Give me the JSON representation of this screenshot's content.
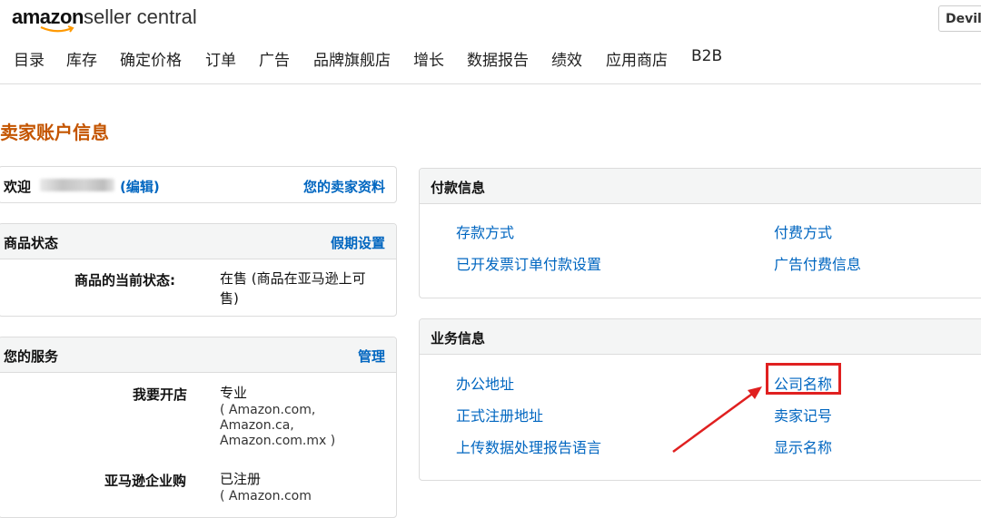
{
  "header": {
    "logo_brand": "amazon",
    "logo_product": "seller central",
    "user_button": "Devily"
  },
  "nav": {
    "items": [
      "目录",
      "库存",
      "确定价格",
      "订单",
      "广告",
      "品牌旗舰店",
      "增长",
      "数据报告",
      "绩效",
      "应用商店",
      "B2B"
    ]
  },
  "page": {
    "title": "卖家账户信息"
  },
  "welcome_card": {
    "welcome": "欢迎",
    "edit": "(编辑)",
    "profile_link": "您的卖家资料"
  },
  "listing_status": {
    "title": "商品状态",
    "vacation_link": "假期设置",
    "label": "商品的当前状态:",
    "value_line1": "在售 (商品在亚马逊上可",
    "value_line2": "售)"
  },
  "services": {
    "title": "您的服务",
    "manage_link": "管理",
    "rows": [
      {
        "label": "我要开店",
        "value": "专业",
        "markets": [
          "( Amazon.com,",
          "Amazon.ca,",
          "Amazon.com.mx )"
        ]
      },
      {
        "label": "亚马逊企业购",
        "value": "已注册",
        "markets": [
          "( Amazon.com"
        ]
      }
    ]
  },
  "payment_info": {
    "title": "付款信息",
    "links": [
      "存款方式",
      "付费方式",
      "已开发票订单付款设置",
      "广告付费信息"
    ]
  },
  "business_info": {
    "title": "业务信息",
    "links": [
      "办公地址",
      "公司名称",
      "正式注册地址",
      "卖家记号",
      "上传数据处理报告语言",
      "显示名称"
    ]
  },
  "colors": {
    "title_orange": "#c45500",
    "link_blue": "#0066c0",
    "highlight_red": "#e02020",
    "header_bg": "#f4f5f5"
  }
}
